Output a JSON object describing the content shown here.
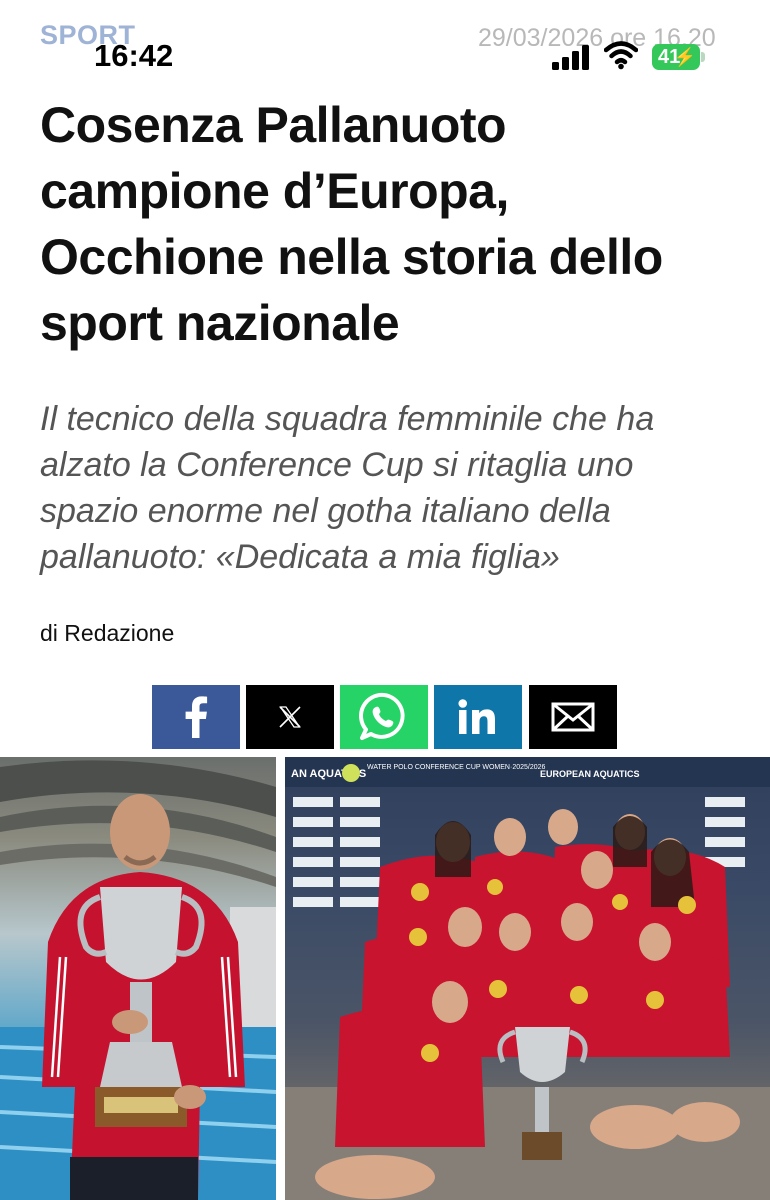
{
  "article": {
    "section": "SPORT",
    "date": "29/03/2026 ore 16.20",
    "headline": "Cosenza Pallanuoto campione d’Europa, Occhione nella storia dello sport nazionale",
    "subtitle": "Il tecnico della squadra femminile che ha alzato la Conference Cup si ritaglia uno spazio enorme nel gotha italiano della pallanuoto: «Dedicata a mia figlia»",
    "byline_prefix": "di",
    "byline_author": "Redazione"
  },
  "status_bar": {
    "time": "16:42",
    "battery": "41"
  },
  "share": {
    "buttons": [
      {
        "name": "facebook",
        "icon": "facebook-icon",
        "color": "#3b5998"
      },
      {
        "name": "x",
        "icon": "x-icon",
        "color": "#000000"
      },
      {
        "name": "whatsapp",
        "icon": "whatsapp-icon",
        "color": "#25d366"
      },
      {
        "name": "linkedin",
        "icon": "linkedin-icon",
        "color": "#0e76a8"
      },
      {
        "name": "email",
        "icon": "mail-icon",
        "color": "#000000"
      }
    ]
  },
  "photo_text": {
    "banner_left": "AN AQUATICS",
    "banner_event": "WATER POLO CONFERENCE CUP WOMEN·2025/2026",
    "banner_right": "EUROPEAN AQUATICS"
  },
  "colors": {
    "section_label": "#9fb3d6",
    "date": "#b8b8b8",
    "battery": "#34c759",
    "subtitle": "#555555"
  }
}
